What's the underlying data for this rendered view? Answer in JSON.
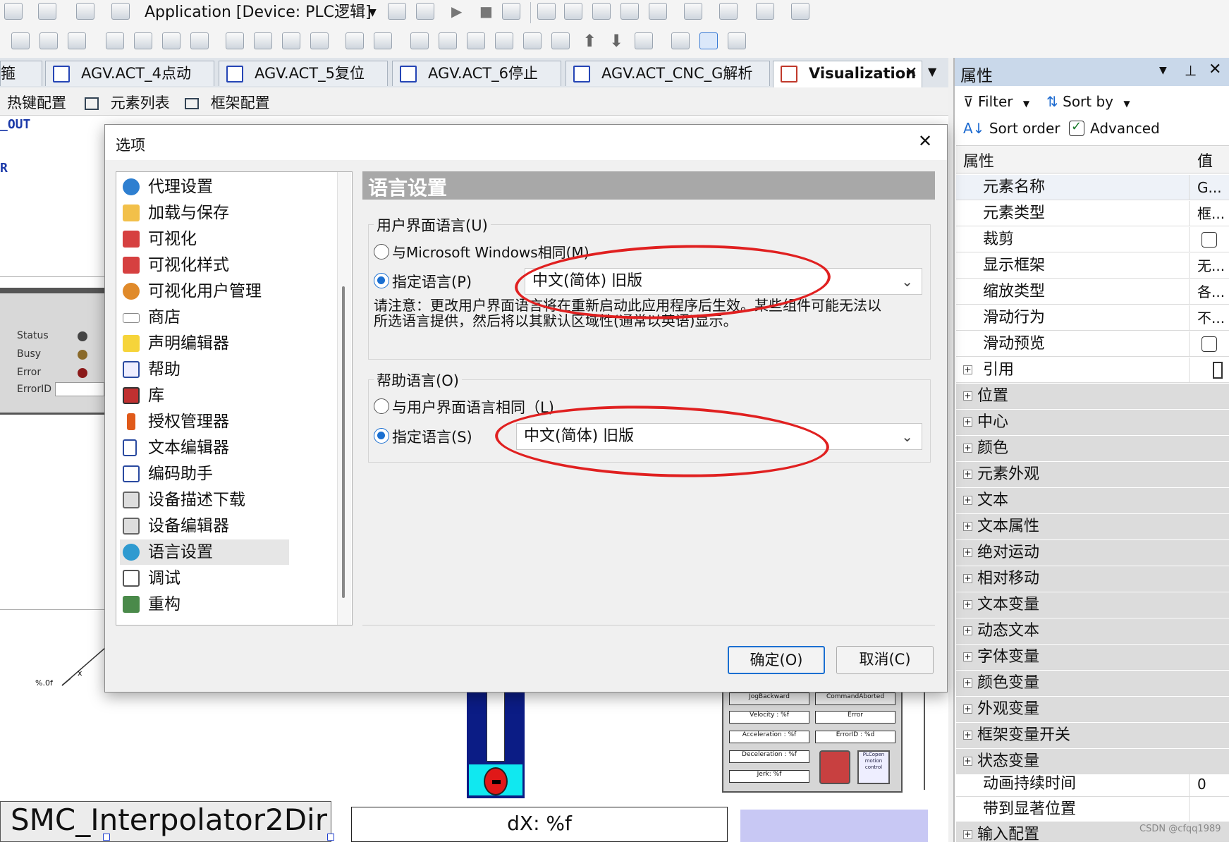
{
  "toolbar": {
    "app_combo": "Application [Device: PLC逻辑]"
  },
  "doc_tabs": [
    {
      "label": "箍"
    },
    {
      "label": "AGV.ACT_4点动"
    },
    {
      "label": "AGV.ACT_5复位"
    },
    {
      "label": "AGV.ACT_6停止"
    },
    {
      "label": "AGV.ACT_CNC_G解析"
    },
    {
      "label": "Visualization"
    }
  ],
  "sub_tabs": [
    "热键配置",
    "元素列表",
    "框架配置"
  ],
  "editor": {
    "code_out": "_OUT",
    "code_r": "R",
    "status_labels": [
      "Status",
      "Busy",
      "Error",
      "ErrorID"
    ],
    "axis_label": "%.0f",
    "axis_x": "x",
    "fb_name": "SMC_Interpolator2Dir",
    "dx_label": "dX: %f",
    "panel_labels": [
      "JogBackward",
      "CommandAborted",
      "Velocity : %f",
      "Error",
      "Acceleration : %f",
      "ErrorID : %d",
      "Deceleration : %f",
      "Jerk: %f"
    ],
    "logo_text": "PLCopen motion control"
  },
  "properties": {
    "title": "属性",
    "filter": "Filter",
    "sort_by": "Sort by",
    "sort_order": "Sort order",
    "advanced": "Advanced",
    "col_name": "属性",
    "col_value": "值",
    "rows": [
      {
        "name": "元素名称",
        "value": "G..."
      },
      {
        "name": "元素类型",
        "value": "框..."
      },
      {
        "name": "裁剪",
        "value": ""
      },
      {
        "name": "显示框架",
        "value": "无..."
      },
      {
        "name": "缩放类型",
        "value": "各..."
      },
      {
        "name": "滑动行为",
        "value": "不..."
      },
      {
        "name": "滑动预览",
        "value": ""
      },
      {
        "name": "引用",
        "value": ""
      },
      {
        "name": "位置",
        "value": ""
      },
      {
        "name": "中心",
        "value": ""
      },
      {
        "name": "颜色",
        "value": ""
      },
      {
        "name": "元素外观",
        "value": ""
      },
      {
        "name": "文本",
        "value": ""
      },
      {
        "name": "文本属性",
        "value": ""
      },
      {
        "name": "绝对运动",
        "value": ""
      },
      {
        "name": "相对移动",
        "value": ""
      },
      {
        "name": "文本变量",
        "value": ""
      },
      {
        "name": "动态文本",
        "value": ""
      },
      {
        "name": "字体变量",
        "value": ""
      },
      {
        "name": "颜色变量",
        "value": ""
      },
      {
        "name": "外观变量",
        "value": ""
      },
      {
        "name": "框架变量开关",
        "value": ""
      },
      {
        "name": "状态变量",
        "value": ""
      },
      {
        "name": "动画持续时间",
        "value": "0"
      },
      {
        "name": "带到显著位置",
        "value": ""
      },
      {
        "name": "输入配置",
        "value": ""
      }
    ]
  },
  "dialog": {
    "title": "选项",
    "nav": [
      "代理设置",
      "加载与保存",
      "可视化",
      "可视化样式",
      "可视化用户管理",
      "商店",
      "声明编辑器",
      "帮助",
      "库",
      "授权管理器",
      "文本编辑器",
      "编码助手",
      "设备描述下载",
      "设备编辑器",
      "语言设置",
      "调试",
      "重构"
    ],
    "section_title": "语言设置",
    "ui_lang": {
      "group": "用户界面语言(U)",
      "opt_windows": "与Microsoft Windows相同(M)",
      "opt_specify": "指定语言(P)",
      "value": "中文(简体) 旧版",
      "note_line1": "请注意：更改用户界面语言将在重新启动此应用程序后生效。某些组件可能无法以",
      "note_line2": "所选语言提供，然后将以其默认区域性(通常以英语)显示。"
    },
    "help_lang": {
      "group": "帮助语言(O)",
      "opt_same": "与用户界面语言相同（L)",
      "opt_specify": "指定语言(S)",
      "value": "中文(简体) 旧版"
    },
    "ok": "确定(O)",
    "cancel": "取消(C)"
  },
  "watermark": "CSDN @cfqq1989"
}
